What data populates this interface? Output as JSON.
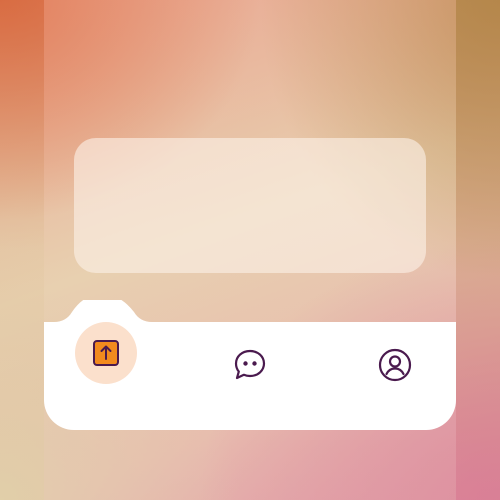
{
  "tabbar": {
    "tabs": [
      {
        "icon": "upload-icon",
        "active": true
      },
      {
        "icon": "chat-bubble-icon",
        "active": false
      },
      {
        "icon": "user-profile-icon",
        "active": false
      }
    ],
    "active_color": "#f28a1e",
    "icon_color": "#4a1a4e"
  }
}
